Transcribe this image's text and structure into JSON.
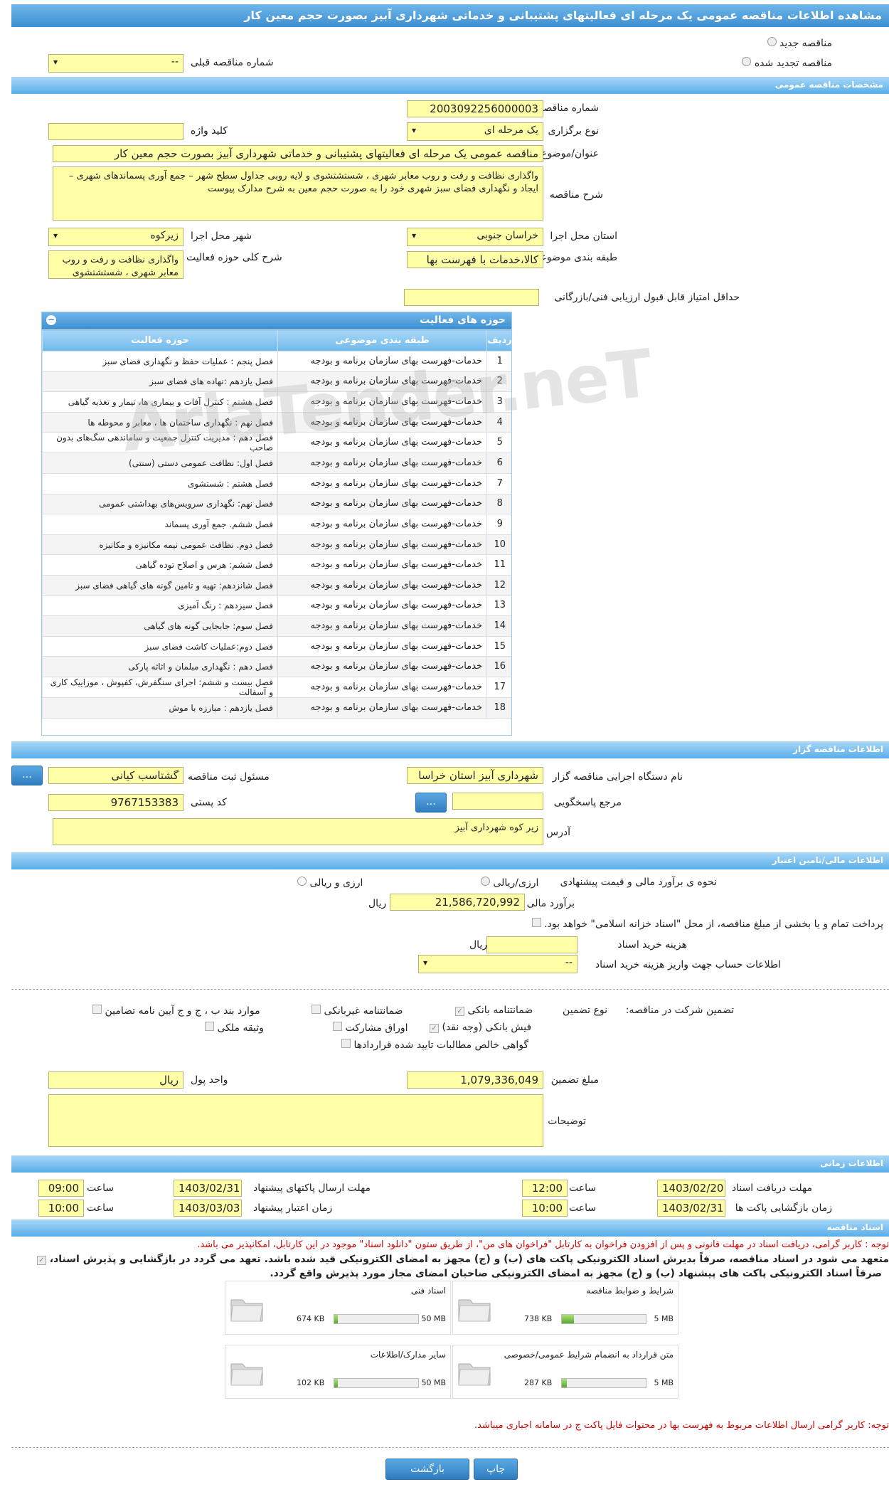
{
  "title": "مشاهده اطلاعات مناقصه عمومی یک مرحله ای فعالیتهای پشتیبانی و خدماتی شهرداری آبیز بصورت حجم معین کار",
  "radios": {
    "new": "مناقصه جدید",
    "renewed": "مناقصه تجدید شده",
    "prev_label": "شماره مناقصه قبلی",
    "prev_value": "--"
  },
  "general": {
    "header": "مشخصات مناقصه عمومی",
    "number_label": "شماره مناقصه",
    "number": "2003092256000003",
    "type_label": "نوع برگزاری",
    "type": "یک مرحله ای",
    "keyword_label": "کلید واژه",
    "keyword": "",
    "subject_label": "عنوان/موضوع مناقصه",
    "subject": "مناقصه عمومی یک مرحله ای فعالیتهای پشتیبانی و خدماتی شهرداری آبیز بصورت حجم معین کار",
    "desc_label": "شرح مناقصه",
    "desc": "واگذاری نظافت و رفت و روب معابر شهری ، شستشتشوی و لایه روبی جداول سطح شهر – جمع آوری پسماندهای شهری – ایجاد و نگهداری فضای سبز شهری خود را به صورت حجم معین به شرح مدارک پیوست",
    "province_label": "استان محل اجرا",
    "province": "خراسان جنوبی",
    "city_label": "شهر محل اجرا",
    "city": "زیرکوه",
    "category_label": "طبقه بندی موضوعی",
    "category": "کالا،خدمات با فهرست بها",
    "activity_desc_label": "شرح کلی حوزه فعالیت",
    "activity_desc": "واگذاری نظافت و رفت و روب معابر شهری ، شستشتشوی",
    "min_score_label": "حداقل امتیاز قابل قبول ارزیابی فنی/بازرگانی",
    "min_score": ""
  },
  "activities": {
    "header": "حوزه های فعالیت",
    "cols": [
      "ردیف",
      "طبقه بندی موضوعی",
      "حوزه فعالیت"
    ],
    "rows": [
      [
        "1",
        "خدمات-فهرست بهای سازمان برنامه و بودجه",
        "فصل پنجم : عملیات حفظ و نگهداری فضای سبز"
      ],
      [
        "2",
        "خدمات-فهرست بهای سازمان برنامه و بودجه",
        "فصل یازدهم :نهاده های فضای سبز"
      ],
      [
        "3",
        "خدمات-فهرست بهای سازمان برنامه و بودجه",
        "فصل هشتم : کنترل آفات و بیماری ها، تیمار و تغذیه گیاهی"
      ],
      [
        "4",
        "خدمات-فهرست بهای سازمان برنامه و بودجه",
        "فصل نهم : نگهداری ساختمان ها ، معابر و محوطه ها"
      ],
      [
        "5",
        "خدمات-فهرست بهای سازمان برنامه و بودجه",
        "فصل دهم : مدیریت کنترل جمعیت و ساماندهی سگ‌های بدون صاحب"
      ],
      [
        "6",
        "خدمات-فهرست بهای سازمان برنامه و بودجه",
        "فصل اول: نظافت عمومی دستی (سنتی)"
      ],
      [
        "7",
        "خدمات-فهرست بهای سازمان برنامه و بودجه",
        "فصل هشتم : شستشوی"
      ],
      [
        "8",
        "خدمات-فهرست بهای سازمان برنامه و بودجه",
        "فصل نهم: نگهداری سرویس‌های بهداشتی عمومی"
      ],
      [
        "9",
        "خدمات-فهرست بهای سازمان برنامه و بودجه",
        "فصل ششم. جمع آوری پسماند"
      ],
      [
        "10",
        "خدمات-فهرست بهای سازمان برنامه و بودجه",
        "فصل دوم. نظافت عمومی نیمه مکانیزه و مکانیزه"
      ],
      [
        "11",
        "خدمات-فهرست بهای سازمان برنامه و بودجه",
        "فصل ششم: هرس و اصلاح توده گیاهی"
      ],
      [
        "12",
        "خدمات-فهرست بهای سازمان برنامه و بودجه",
        "فصل شانزدهم: تهیه و تامین گونه های گیاهی فضای سبز"
      ],
      [
        "13",
        "خدمات-فهرست بهای سازمان برنامه و بودجه",
        "فصل سیزدهم : رنگ آمیزی"
      ],
      [
        "14",
        "خدمات-فهرست بهای سازمان برنامه و بودجه",
        "فصل سوم: جابجایی گونه های گیاهی"
      ],
      [
        "15",
        "خدمات-فهرست بهای سازمان برنامه و بودجه",
        "فصل دوم:عملیات کاشت فضای سبز"
      ],
      [
        "16",
        "خدمات-فهرست بهای سازمان برنامه و بودجه",
        "فصل دهم : نگهداری مبلمان و اثاثه پارکی"
      ],
      [
        "17",
        "خدمات-فهرست بهای سازمان برنامه و بودجه",
        "فصل بیست و ششم: اجرای سنگفرش، کفپوش ، موزاییک کاری و آسفالت"
      ],
      [
        "18",
        "خدمات-فهرست بهای سازمان برنامه و بودجه",
        "فصل یازدهم : مبارزه با موش"
      ]
    ]
  },
  "organizer": {
    "header": "اطلاعات مناقصه گزار",
    "device_label": "نام دستگاه اجرایی مناقصه گزار",
    "device": "شهرداری آبیز استان خراسا",
    "registrar_label": "مسئول ثبت مناقصه",
    "registrar": "گشتاسب کیانی",
    "ref_label": "مرجع پاسخگویی",
    "ref": "",
    "postal_label": "کد پستی",
    "postal": "9767153383",
    "address_label": "آدرس",
    "address": "زیر کوه شهرداری آبیز",
    "dots": "..."
  },
  "finance": {
    "header": "اطلاعات مالی/تامین اعتبار",
    "method_label": "نحوه ی برآورد مالی و قیمت پیشنهادی",
    "opt1": "ارزی/ریالی",
    "opt2": "ارزی و ریالی",
    "estimate_label": "برآورد مالی",
    "estimate": "21,586,720,992",
    "rial": "ریال",
    "islamic": "پرداخت تمام و یا بخشی از مبلغ مناقصه، از محل \"اسناد خزانه اسلامی\" خواهد بود.",
    "doc_fee_label": "هزینه خرید اسناد",
    "doc_fee": "",
    "account_label": "اطلاعات حساب جهت واریز هزینه خرید اسناد",
    "account": "--",
    "guarantee_label": "تضمین شرکت در مناقصه:",
    "guarantee_type_label": "نوع تضمین",
    "g1": "ضمانتنامه بانکی",
    "g2": "ضمانتنامه غیربانکی",
    "g3": "موارد بند ب ، ج و ج آیین نامه تضامین",
    "g4": "فیش بانکی (وجه نقد)",
    "g5": "اوراق مشارکت",
    "g6": "وثیقه ملکی",
    "g7": "گواهی خالص مطالبات تایید شده قراردادها",
    "amount_label": "مبلغ تضمین",
    "amount": "1,079,336,049",
    "currency_label": "واحد پول",
    "currency": "ریال",
    "notes_label": "توضیحات",
    "notes": ""
  },
  "timing": {
    "header": "اطلاعات زمانی",
    "receive_label": "مهلت دریافت اسناد",
    "receive_date": "1403/02/20",
    "receive_time": "12:00",
    "send_label": "مهلت ارسال پاکتهای پیشنهاد",
    "send_date": "1403/02/31",
    "send_time": "09:00",
    "open_label": "زمان بازگشایی پاکت ها",
    "open_date": "1403/02/31",
    "open_time": "10:00",
    "valid_label": "زمان اعتبار پیشنهاد",
    "valid_date": "1403/03/03",
    "valid_time": "10:00",
    "time_label": "ساعت"
  },
  "docs": {
    "header": "اسناد مناقصه",
    "note1": "توجه : کاربر گرامی، دریافت اسناد در مهلت قانونی و پس از افزودن فراخوان به کارتابل \"فراخوان های من\"، از طریق ستون \"دانلود اسناد\" موجود در این کارتابل، امکانپذیر می باشد.",
    "note2": "متعهد می شود در اسناد مناقصه، صرفاً بدیرش اسناد الکترونیکی پاکت های (ب) و (ج) مجهز به امضای الکترونیکی قید شده باشد. تعهد می گردد در بازگشایی و پذیرش اسناد،",
    "note3": "صرفاً اسناد الکترونیکی پاکت های پیشنهاد (ب) و (ج) مجهز به امضای الکترونیکی صاحبان امضای مجاز مورد پذیرش واقع گردد.",
    "files": [
      {
        "name": "شرایط و ضوابط مناقصه",
        "size": "738 KB",
        "max": "5 MB",
        "fill": 0.14
      },
      {
        "name": "اسناد فنی",
        "size": "674 KB",
        "max": "50 MB",
        "fill": 0.02
      },
      {
        "name": "متن قرارداد به انضمام شرایط عمومی/خصوصی",
        "size": "287 KB",
        "max": "5 MB",
        "fill": 0.06
      },
      {
        "name": "سایر مدارک/اطلاعات",
        "size": "102 KB",
        "max": "50 MB",
        "fill": 0.01
      }
    ],
    "note4": "توجه: کاربر گرامی ارسال اطلاعات مربوط به فهرست بها در محتوات فایل پاکت ج در سامانه اجباری میباشد."
  },
  "buttons": {
    "print": "چاپ",
    "back": "بازگشت"
  },
  "watermark": "AriaTender.neT"
}
